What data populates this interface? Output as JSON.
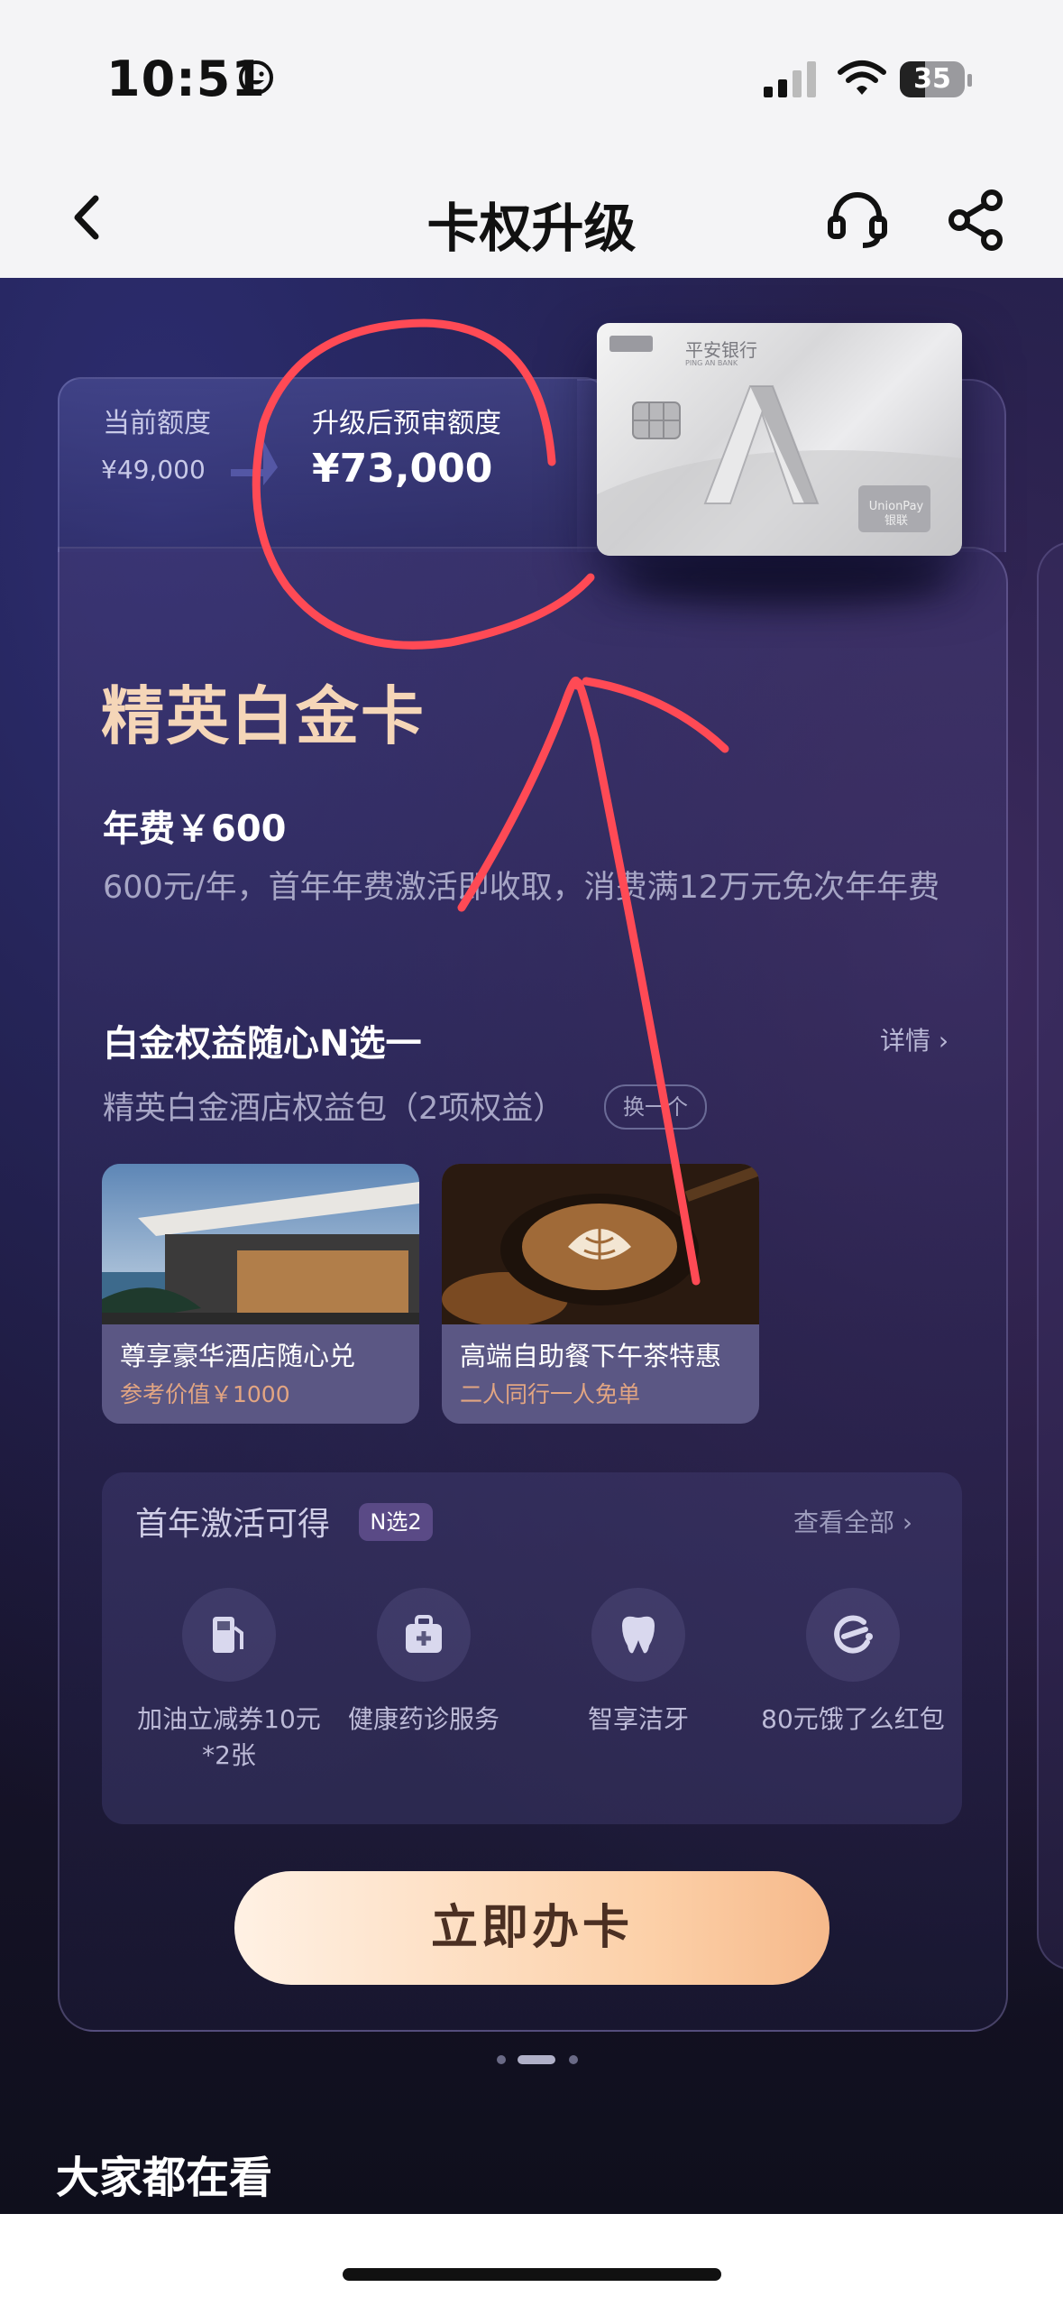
{
  "status_bar": {
    "time": "10:51",
    "battery": "35"
  },
  "nav": {
    "title": "卡权升级"
  },
  "quota": {
    "current_label": "当前额度",
    "current_value": "¥49,000",
    "new_label": "升级后预审额度",
    "new_value": "¥73,000"
  },
  "bank_card": {
    "bank_name": "平安银行",
    "bank_name_en": "PING AN BANK",
    "network": "UnionPay 银联"
  },
  "card": {
    "name": "精英白金卡",
    "fee_title": "年费￥600",
    "fee_desc": "600元/年，首年年费激活即收取，消费满12万元免次年年费"
  },
  "benefits": {
    "title": "白金权益随心N选一",
    "detail": "详情",
    "subtitle": "精英白金酒店权益包（2项权益）",
    "swap": "换一个",
    "items": [
      {
        "title": "尊享豪华酒店随心兑",
        "subtitle": "参考价值￥1000"
      },
      {
        "title": "高端自助餐下午茶特惠",
        "subtitle": "二人同行一人免单"
      }
    ]
  },
  "first_year": {
    "title": "首年激活可得",
    "badge": "N选2",
    "view_all": "查看全部",
    "items": [
      {
        "label": "加油立减券10元*2张",
        "icon": "fuel-icon"
      },
      {
        "label": "健康药诊服务",
        "icon": "medical-kit-icon"
      },
      {
        "label": "智享洁牙",
        "icon": "tooth-icon"
      },
      {
        "label": "80元饿了么红包",
        "icon": "eleme-icon"
      }
    ]
  },
  "cta": {
    "label": "立即办卡"
  },
  "section": {
    "title": "大家都在看"
  },
  "colors": {
    "accent": "#f5d6b8",
    "cta_start": "#fff1e4",
    "cta_end": "#f6b98b",
    "annotation": "#ff4a55"
  }
}
